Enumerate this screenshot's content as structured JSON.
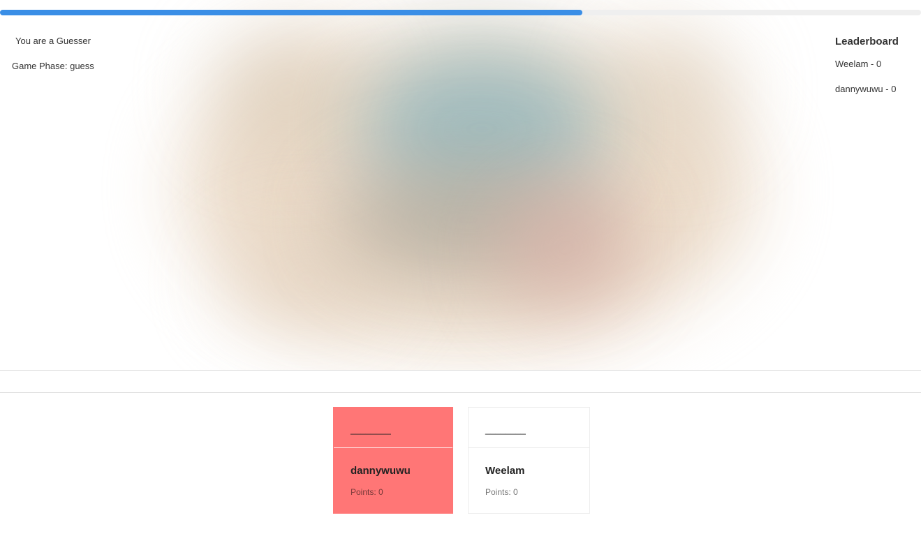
{
  "progress": {
    "fraction": 0.632,
    "color": "#3a8ee6"
  },
  "status": {
    "role": "You are a Guesser",
    "phase": "Game Phase: guess"
  },
  "leaderboard": {
    "title": "Leaderboard",
    "entries": [
      {
        "text": "Weelam - 0"
      },
      {
        "text": "dannywuwu - 0"
      }
    ]
  },
  "players": [
    {
      "word": "________",
      "name": "dannywuwu",
      "points": "Points: 0",
      "active": true
    },
    {
      "word": "________",
      "name": "Weelam",
      "points": "Points: 0",
      "active": false
    }
  ],
  "colors": {
    "active_card": "#ff7676",
    "divider": "#dedede"
  }
}
